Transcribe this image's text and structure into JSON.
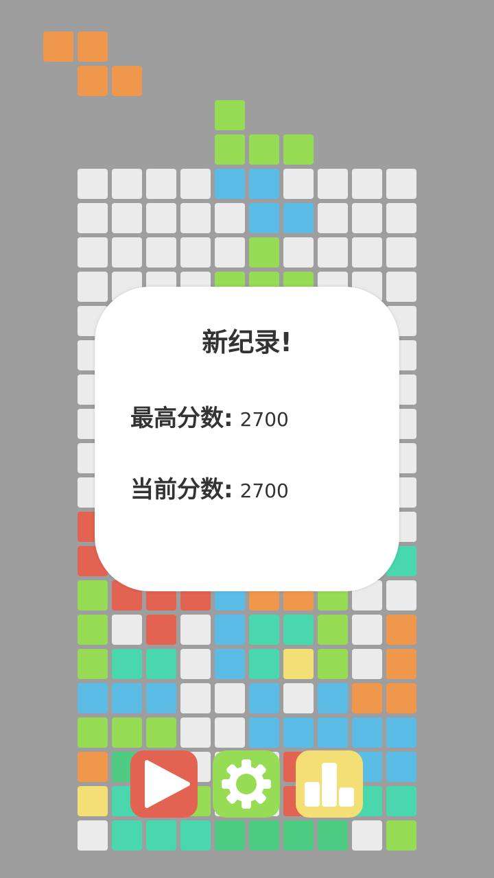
{
  "colors": {
    "background": "#9e9e9e",
    "empty": "#ebebeb",
    "palette": {
      "W": "#ebebeb",
      "O": "#ef984b",
      "G": "#97dc55",
      "B": "#5bbde6",
      "R": "#e26352",
      "T": "#49d7ae",
      "D": "#4fcc83",
      "Y": "#f3df76"
    }
  },
  "falling_pieces": [
    {
      "color": "O",
      "cells": [
        [
          -5,
          0
        ],
        [
          -4,
          0
        ],
        [
          -4,
          1
        ],
        [
          -3,
          1
        ]
      ]
    },
    {
      "color": "G",
      "cells": [
        [
          0,
          2
        ],
        [
          0,
          3
        ],
        [
          1,
          3
        ],
        [
          2,
          3
        ]
      ]
    }
  ],
  "board": {
    "columns": 10,
    "rows": [
      "WWWWBBWWWW",
      "WWWWWBBWWW",
      "WWWWWGWWWW",
      "WWWWGGGWWW",
      "WWWWWWWWWW",
      "WWWWWWWWWW",
      "WWWWWWWWWW",
      "WWWWWWWWWW",
      "WWWWWWWWWW",
      "WWWWWWWWWW",
      "RWWWWWWWWW",
      "RWWWWWWWWT",
      "GRRRBOOGWW",
      "GWRWBTTGWO",
      "GTTWBTYGWO",
      "BBBWWBWBOO",
      "GGGWWBBBBB",
      "ODWWWWRWBB",
      "YTWGWWRWTT",
      "WTTTDDDDWG"
    ]
  },
  "dialog": {
    "title": "新纪录!",
    "best_label": "最高分数:",
    "best_value": "2700",
    "current_label": "当前分数:",
    "current_value": "2700"
  },
  "buttons": [
    {
      "name": "play-button",
      "icon": "play-icon",
      "color": "#e26352"
    },
    {
      "name": "settings-button",
      "icon": "gear-icon",
      "color": "#97dc55"
    },
    {
      "name": "leaderboard-button",
      "icon": "bar-chart-icon",
      "color": "#f3df76"
    }
  ]
}
